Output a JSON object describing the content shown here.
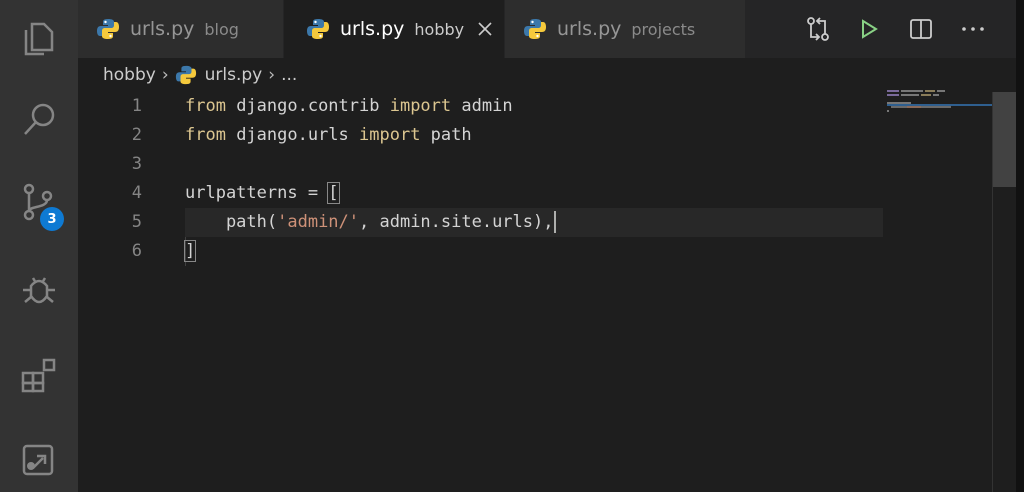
{
  "activity_bar": {
    "items": [
      {
        "icon": "files-icon"
      },
      {
        "icon": "search-icon"
      },
      {
        "icon": "source-control-icon",
        "badge": "3"
      },
      {
        "icon": "debug-icon"
      },
      {
        "icon": "extensions-icon"
      },
      {
        "icon": "remote-explorer-icon"
      }
    ]
  },
  "tabs": [
    {
      "name": "urls.py",
      "dir": "blog",
      "active": false
    },
    {
      "name": "urls.py",
      "dir": "hobby",
      "active": true
    },
    {
      "name": "urls.py",
      "dir": "projects",
      "active": false
    }
  ],
  "toolbar": {
    "icons": [
      "compare-changes-icon",
      "run-icon",
      "split-editor-icon",
      "more-actions-icon"
    ]
  },
  "breadcrumb": {
    "folder": "hobby",
    "file": "urls.py",
    "more": "..."
  },
  "editor": {
    "line_numbers": [
      "1",
      "2",
      "3",
      "4",
      "5",
      "6"
    ],
    "lines": {
      "l1": {
        "kw1": "from",
        "mod": " django.contrib ",
        "kw2": "import",
        "name": " admin"
      },
      "l2": {
        "kw1": "from",
        "mod": " django.urls ",
        "kw2": "import",
        "name": " path"
      },
      "l4": {
        "var": "urlpatterns = ",
        "bracket": "["
      },
      "l5": {
        "pre": "    path(",
        "str": "'admin/'",
        "post": ", admin.site.urls),"
      },
      "l6": {
        "bracket": "]"
      }
    }
  },
  "colors": {
    "accent": "#0e7ad3",
    "keyword": "#c586c0",
    "string": "#ce9178",
    "run_icon": "#89d185"
  }
}
